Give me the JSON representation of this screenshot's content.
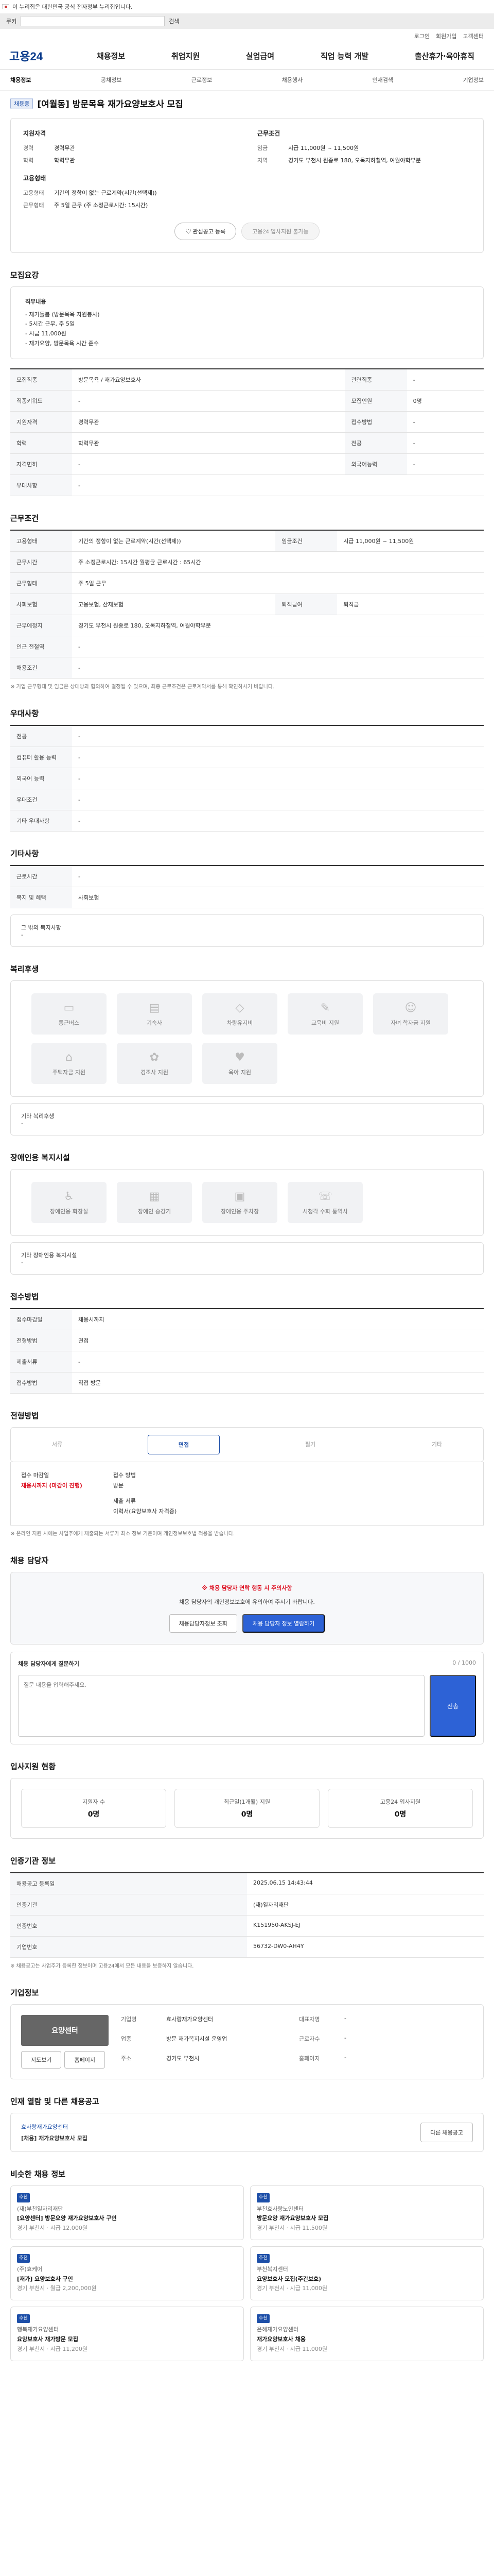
{
  "gov_bar": {
    "text": "이 누리집은 대한민국 공식 전자정부 누리집입니다."
  },
  "cookie": {
    "label": "쿠키",
    "button": "검색"
  },
  "util": [
    "로그인",
    "회원가입",
    "고객센터"
  ],
  "header": {
    "logo": "고용24",
    "gnb": [
      "채용정보",
      "취업지원",
      "실업급여",
      "직업 능력 개발",
      "출산휴가·육아휴직"
    ]
  },
  "subnav": [
    "채용정보",
    "공채정보",
    "근로정보",
    "채용행사",
    "인재검색",
    "기업정보"
  ],
  "job": {
    "status": "채용중",
    "title": "[여월동] 방문목욕 재가요양보호사 모집"
  },
  "summary": {
    "left_head": "지원자격",
    "left": [
      {
        "k": "경력",
        "v": "경력무관"
      },
      {
        "k": "학력",
        "v": "학력무관"
      }
    ],
    "left2_head": "고용형태",
    "left2": [
      {
        "k": "고용형태",
        "v": "기간의 정함이 없는 근로계약(시간(선택제))"
      },
      {
        "k": "근무형태",
        "v": "주 5일 근무 (주 소정근로시간: 15시간)"
      }
    ],
    "right_head": "근무조건",
    "right": [
      {
        "k": "임금",
        "v": "시급 11,000원 ~ 11,500원"
      },
      {
        "k": "지역",
        "v": "경기도 부천시 원종로 180, 오목지하철역, 여월야학부분"
      }
    ],
    "btn_interest": "관심공고 등록",
    "btn_apply": "고용24 입사지원 불가능"
  },
  "org": {
    "head": "모집요강",
    "name": "직무내용",
    "lines": [
      "- 재가돌봄 (방문목욕 자원봉사)",
      "- 5시간 근무, 주 5일",
      "- 시급 11,000원",
      "- 재가요양, 방문목욕 시간 준수"
    ]
  },
  "recruit_rows": [
    [
      "모집직종",
      "방문목욕 / 재가요양보호사",
      "관련직종",
      "-"
    ],
    [
      "직종키워드",
      "-",
      "모집인원",
      "0명"
    ],
    [
      "지원자격",
      "경력무관",
      "접수방법",
      "-"
    ],
    [
      "학력",
      "학력무관",
      "전공",
      "-"
    ],
    [
      "자격면허",
      "-",
      "외국어능력",
      "-"
    ],
    [
      "우대사항",
      "-",
      "",
      ""
    ]
  ],
  "cond_head": "근무조건",
  "cond_rows": [
    [
      "고용형태",
      "기간의 정함이 없는 근로계약(시간(선택제))",
      "임금조건",
      "시급 11,000원 ~ 11,500원"
    ],
    [
      "근무시간",
      "주 소정근로시간: 15시간\n월평균 근로시간 : 65시간",
      "",
      ""
    ],
    [
      "근무형태",
      "주 5일 근무",
      "",
      ""
    ],
    [
      "사회보험",
      "고용보험, 산재보험",
      "퇴직급여",
      "퇴직금"
    ],
    [
      "근무예정지",
      "경기도 부천시 원종로 180, 오목지하철역, 여월야학부분",
      "",
      ""
    ],
    [
      "인근 전철역",
      "-",
      "",
      ""
    ],
    [
      "채용조건",
      "-",
      "",
      ""
    ]
  ],
  "cond_note": "※ 기업 근무형태 및 임금은 상대방과 협의하여 결정될 수 있으며, 최종 근로조건은 근로계약서를 통해 확인하시기 바랍니다.",
  "pref_head": "우대사항",
  "pref_rows": [
    [
      "전공",
      "-"
    ],
    [
      "컴퓨터 활용 능력",
      "-"
    ],
    [
      "외국어 능력",
      "-"
    ],
    [
      "우대조건",
      "-"
    ],
    [
      "기타 우대사항",
      "-"
    ]
  ],
  "etc_head": "기타사항",
  "etc_rows": [
    [
      "근로시간",
      "-"
    ],
    [
      "복지 및 혜택",
      "사회보험"
    ]
  ],
  "etc_extra": [
    "그 밖의 복지사항",
    "-"
  ],
  "welfare_head": "복리후생",
  "welfare": [
    "통근버스",
    "기숙사",
    "차량유지비",
    "교육비 지원",
    "자녀 학자금 지원",
    "주택자금 지원",
    "경조사 지원",
    "육아 지원"
  ],
  "welfare_other": {
    "label": "기타 복리후생",
    "value": "-"
  },
  "disability_head": "장애인용 복지시설",
  "disability": [
    "장애인용 화장실",
    "장애인 승강기",
    "장애인용 주차장",
    "시청각 수화 통역사"
  ],
  "disability_other": {
    "label": "기타 장애인용 복지시설",
    "value": "-"
  },
  "reception_head": "접수방법",
  "reception_rows": [
    [
      "접수마감일",
      "채용시까지"
    ],
    [
      "전형방법",
      "면접"
    ],
    [
      "제출서류",
      "-"
    ],
    [
      "접수방법",
      "직접 방문"
    ]
  ],
  "process_head": "전형방법",
  "process": [
    "서류",
    "면접",
    "필기",
    "기타"
  ],
  "process_detail": {
    "left_title": "접수 마감일",
    "left_value": "채용시까지 (마감이 진행)",
    "right_title": "접수 방법",
    "right_value": "방문",
    "docs_title": "제출 서류",
    "docs_value": "이력서(요양보호사 자격증)"
  },
  "process_note": "※ 온라인 지원 시에는 사업주에게 제출되는 서류가 최소 정보 기준이며 개인정보보호법 적용을 받습니다.",
  "contact": {
    "head": "채용 담당자",
    "lead": "※ 채용 담당자 연락 행동 시 주의사항",
    "desc": "채용 담당자의 개인정보보호에 유의하여 주시기 바랍니다.",
    "btn_copy": "채용담당자정보 조회",
    "btn_view": "채용 담당자 정보 열람하기"
  },
  "inquiry": {
    "head": "채용 담당자에게 질문하기",
    "placeholder": "질문 내용을 입력해주세요.",
    "send": "전송",
    "count": "0 / 1000"
  },
  "stats_head": "입사지원 현황",
  "stats": [
    {
      "label": "지원자 수",
      "value": "0명"
    },
    {
      "label": "최근일(1개월) 지원",
      "value": "0명"
    },
    {
      "label": "고용24 입사지원",
      "value": "0명"
    }
  ],
  "manager_head": "인증기관 정보",
  "manager_rows": [
    [
      "채용공고 등록일",
      "2025.06.15 14:43:44"
    ],
    [
      "인증기관",
      "(재)일자리재단"
    ],
    [
      "인증번호",
      "K151950-AKSJ-EJ"
    ],
    [
      "기업번호",
      "56732-DW0-AH4Y"
    ]
  ],
  "manager_note": "※ 채용공고는 사업주가 등록한 정보이며 고용24에서 모든 내용을 보증하지 않습니다.",
  "company_head": "기업정보",
  "company": {
    "logo": "요양센터",
    "rows": [
      [
        "기업명",
        "효사랑재가요양센터"
      ],
      [
        "대표자명",
        "-"
      ],
      [
        "업종",
        "방문 재가복지시설 운영업"
      ],
      [
        "근로자수",
        "-"
      ],
      [
        "주소",
        "경기도 부천시"
      ],
      [
        "홈페이지",
        "-"
      ]
    ],
    "btn_map": "지도보기",
    "btn_home": "홈페이지"
  },
  "rec_head": "인재 열람 및 다른 채용공고",
  "rec": {
    "company": "효사랑재가요양센터",
    "title": "[채용] 재가요양보호사 모집",
    "btn": "다른 채용공고"
  },
  "similar_head": "비슷한 채용 정보",
  "similar": [
    {
      "tag": "추천",
      "co": "(재)부천일자리재단",
      "title": "[요양센터] 방문요양 재가요양보호사 구인",
      "loc": "경기 부천시",
      "pay": "시급 12,000원"
    },
    {
      "tag": "추천",
      "co": "부천효사랑노인센터",
      "title": "방문요양 재가요양보호사 모집",
      "loc": "경기 부천시",
      "pay": "시급 11,500원"
    },
    {
      "tag": "추천",
      "co": "(주)효케어",
      "title": "[재가] 요양보호사 구인",
      "loc": "경기 부천시",
      "pay": "월급 2,200,000원"
    },
    {
      "tag": "추천",
      "co": "부천복지센터",
      "title": "요양보호사 모집(주간보호)",
      "loc": "경기 부천시",
      "pay": "시급 11,000원"
    },
    {
      "tag": "추천",
      "co": "행복재가요양센터",
      "title": "요양보호사 재가방문 모집",
      "loc": "경기 부천시",
      "pay": "시급 11,200원"
    },
    {
      "tag": "추천",
      "co": "은혜재가요양센터",
      "title": "재가요양보호사 채용",
      "loc": "경기 부천시",
      "pay": "시급 11,000원"
    }
  ]
}
